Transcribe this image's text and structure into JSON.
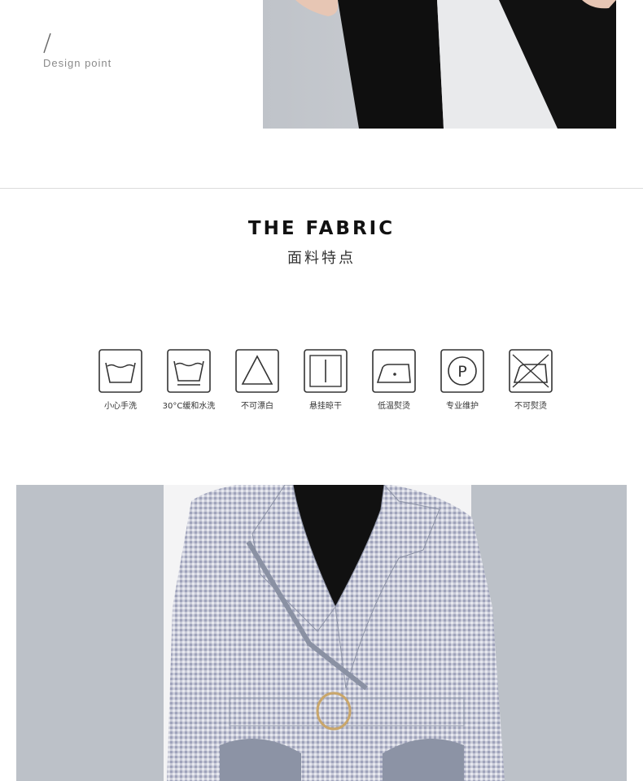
{
  "design_point": {
    "slash": "/",
    "label": "Design point"
  },
  "fabric": {
    "title_en": "THE FABRIC",
    "title_cn": "面料特点"
  },
  "care_icons": [
    {
      "icon": "hand-wash-icon",
      "label": "小心手洗"
    },
    {
      "icon": "wash-30-icon",
      "label": "30°C缓和水洗"
    },
    {
      "icon": "bleach-icon",
      "label": "不可漂白"
    },
    {
      "icon": "hang-dry-icon",
      "label": "悬挂晾干"
    },
    {
      "icon": "low-iron-icon",
      "label": "低温熨烫"
    },
    {
      "icon": "dry-clean-p-icon",
      "label": "专业维护"
    },
    {
      "icon": "no-iron-icon",
      "label": "不可熨烫"
    }
  ],
  "colors": {
    "photo_background": "#bcc1c8",
    "divider": "#dcdcdc"
  }
}
